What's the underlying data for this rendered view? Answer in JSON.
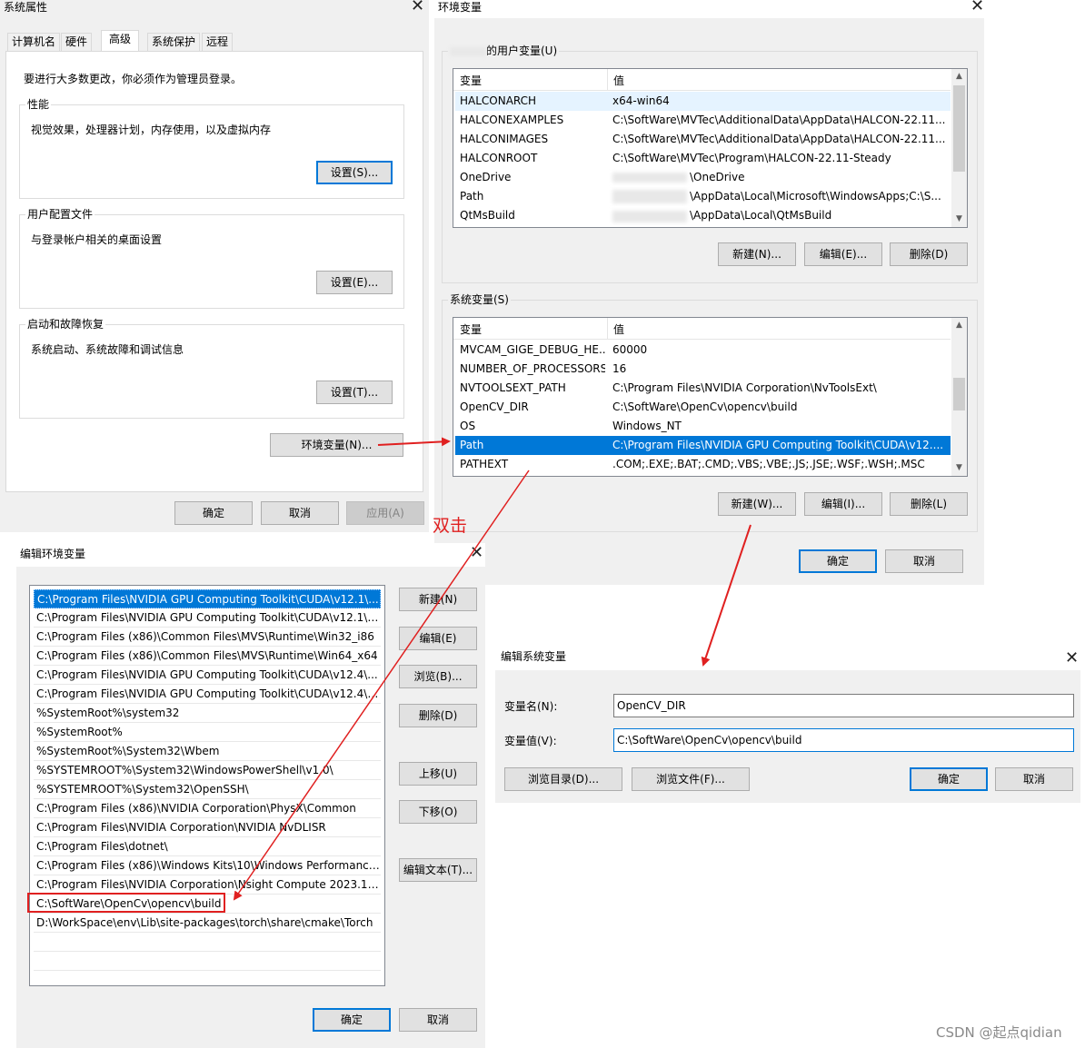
{
  "system_properties": {
    "title": "系统属性",
    "tabs": [
      "计算机名",
      "硬件",
      "高级",
      "系统保护",
      "远程"
    ],
    "notice": "要进行大多数更改，你必须作为管理员登录。",
    "performance": {
      "label": "性能",
      "desc": "视觉效果，处理器计划，内存使用，以及虚拟内存",
      "button": "设置(S)..."
    },
    "user_profiles": {
      "label": "用户配置文件",
      "desc": "与登录帐户相关的桌面设置",
      "button": "设置(E)..."
    },
    "startup_recovery": {
      "label": "启动和故障恢复",
      "desc": "系统启动、系统故障和调试信息",
      "button": "设置(T)..."
    },
    "env_button": "环境变量(N)...",
    "ok": "确定",
    "cancel": "取消",
    "apply": "应用(A)"
  },
  "env_vars": {
    "title": "环境变量",
    "user_label": "的用户变量(U)",
    "col_var": "变量",
    "col_val": "值",
    "user_rows": [
      {
        "name": "HALCONARCH",
        "value": "x64-win64"
      },
      {
        "name": "HALCONEXAMPLES",
        "value": "C:\\SoftWare\\MVTec\\AdditionalData\\AppData\\HALCON-22.11..."
      },
      {
        "name": "HALCONIMAGES",
        "value": "C:\\SoftWare\\MVTec\\AdditionalData\\AppData\\HALCON-22.11..."
      },
      {
        "name": "HALCONROOT",
        "value": "C:\\SoftWare\\MVTec\\Program\\HALCON-22.11-Steady"
      },
      {
        "name": "OneDrive",
        "value": "\\OneDrive"
      },
      {
        "name": "Path",
        "value": "\\AppData\\Local\\Microsoft\\WindowsApps;C:\\S..."
      },
      {
        "name": "QtMsBuild",
        "value": "\\AppData\\Local\\QtMsBuild"
      }
    ],
    "user_new": "新建(N)...",
    "user_edit": "编辑(E)...",
    "user_delete": "删除(D)",
    "sys_label": "系统变量(S)",
    "sys_rows": [
      {
        "name": "MVCAM_GIGE_DEBUG_HE...",
        "value": "60000"
      },
      {
        "name": "NUMBER_OF_PROCESSORS",
        "value": "16"
      },
      {
        "name": "NVTOOLSEXT_PATH",
        "value": "C:\\Program Files\\NVIDIA Corporation\\NvToolsExt\\"
      },
      {
        "name": "OpenCV_DIR",
        "value": "C:\\SoftWare\\OpenCv\\opencv\\build"
      },
      {
        "name": "OS",
        "value": "Windows_NT"
      },
      {
        "name": "Path",
        "value": "C:\\Program Files\\NVIDIA GPU Computing Toolkit\\CUDA\\v12...."
      },
      {
        "name": "PATHEXT",
        "value": ".COM;.EXE;.BAT;.CMD;.VBS;.VBE;.JS;.JSE;.WSF;.WSH;.MSC"
      }
    ],
    "sys_new": "新建(W)...",
    "sys_edit": "编辑(I)...",
    "sys_delete": "删除(L)",
    "ok": "确定",
    "cancel": "取消"
  },
  "annotation": "双击",
  "edit_env": {
    "title": "编辑环境变量",
    "items": [
      "C:\\Program Files\\NVIDIA GPU Computing Toolkit\\CUDA\\v12.1\\...",
      "C:\\Program Files\\NVIDIA GPU Computing Toolkit\\CUDA\\v12.1\\li...",
      "C:\\Program Files (x86)\\Common Files\\MVS\\Runtime\\Win32_i86",
      "C:\\Program Files (x86)\\Common Files\\MVS\\Runtime\\Win64_x64",
      "C:\\Program Files\\NVIDIA GPU Computing Toolkit\\CUDA\\v12.4\\...",
      "C:\\Program Files\\NVIDIA GPU Computing Toolkit\\CUDA\\v12.4\\li...",
      "%SystemRoot%\\system32",
      "%SystemRoot%",
      "%SystemRoot%\\System32\\Wbem",
      "%SYSTEMROOT%\\System32\\WindowsPowerShell\\v1.0\\",
      "%SYSTEMROOT%\\System32\\OpenSSH\\",
      "C:\\Program Files (x86)\\NVIDIA Corporation\\PhysX\\Common",
      "C:\\Program Files\\NVIDIA Corporation\\NVIDIA NvDLISR",
      "C:\\Program Files\\dotnet\\",
      "C:\\Program Files (x86)\\Windows Kits\\10\\Windows Performance ...",
      "C:\\Program Files\\NVIDIA Corporation\\Nsight Compute 2023.1.0\\",
      "C:\\SoftWare\\OpenCv\\opencv\\build",
      "D:\\WorkSpace\\env\\Lib\\site-packages\\torch\\share\\cmake\\Torch"
    ],
    "buttons": {
      "new": "新建(N)",
      "edit": "编辑(E)",
      "browse": "浏览(B)...",
      "delete": "删除(D)",
      "up": "上移(U)",
      "down": "下移(O)",
      "edit_text": "编辑文本(T)..."
    },
    "ok": "确定",
    "cancel": "取消"
  },
  "edit_sys": {
    "title": "编辑系统变量",
    "name_label": "变量名(N):",
    "name_value": "OpenCV_DIR",
    "value_label": "变量值(V):",
    "value_value": "C:\\SoftWare\\OpenCv\\opencv\\build",
    "browse_dir": "浏览目录(D)...",
    "browse_file": "浏览文件(F)...",
    "ok": "确定",
    "cancel": "取消"
  },
  "watermark": "CSDN @起点qidian",
  "colors": {
    "selection": "#0078d7",
    "annotation_red": "#e02020",
    "dialog_bg": "#f0f0f0"
  }
}
